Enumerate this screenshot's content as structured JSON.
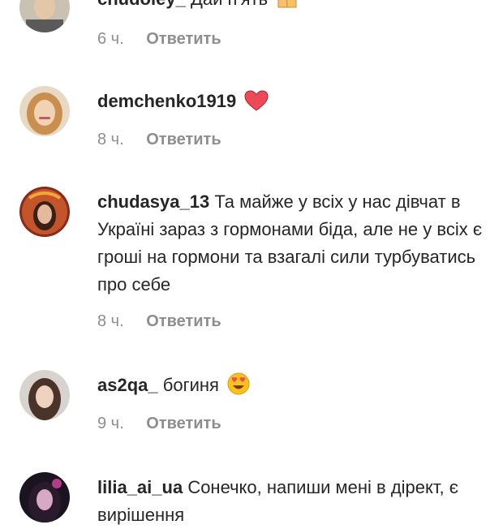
{
  "comments": [
    {
      "username": "chudoley_",
      "text": "Дай п'ять",
      "emoji": "raising-hands",
      "time": "6 ч.",
      "reply_label": "Ответить"
    },
    {
      "username": "demchenko1919",
      "text": "",
      "emoji": "red-heart",
      "time": "8 ч.",
      "reply_label": "Ответить"
    },
    {
      "username": "chudasya_13",
      "text": "Та майже у всіх у нас дівчат в Україні зараз з гормонами біда, але не у всіх є гроші на гормони та взагалі сили турбуватись про себе",
      "emoji": "",
      "time": "8 ч.",
      "reply_label": "Ответить"
    },
    {
      "username": "as2qa_",
      "text": "богиня",
      "emoji": "heart-eyes",
      "time": "9 ч.",
      "reply_label": "Ответить"
    },
    {
      "username": "lilia_ai_ua",
      "text": "Сонечко, напиши мені в дірект, є вирішення",
      "emoji": "",
      "time": "",
      "reply_label": ""
    }
  ],
  "colors": {
    "text": "#262626",
    "secondary": "#8e8e8e",
    "heart": "#ed4956"
  }
}
